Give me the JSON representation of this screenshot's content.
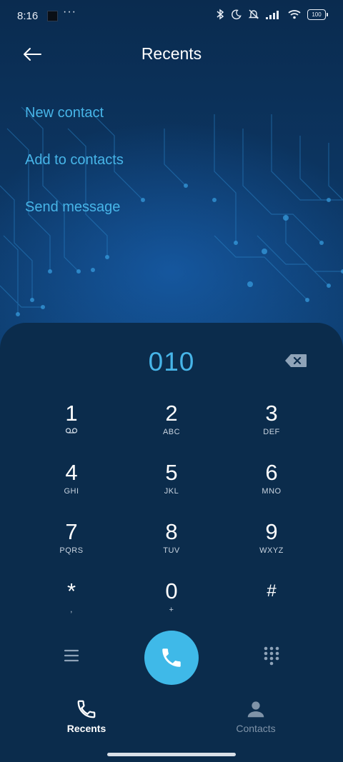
{
  "status_bar": {
    "time": "8:16",
    "more_dots": "···",
    "battery": "100"
  },
  "header": {
    "title": "Recents"
  },
  "actions": [
    {
      "label": "New contact"
    },
    {
      "label": "Add to contacts"
    },
    {
      "label": "Send message"
    }
  ],
  "dialer": {
    "number": "010",
    "keys": [
      {
        "digit": "1",
        "letters": ""
      },
      {
        "digit": "2",
        "letters": "ABC"
      },
      {
        "digit": "3",
        "letters": "DEF"
      },
      {
        "digit": "4",
        "letters": "GHI"
      },
      {
        "digit": "5",
        "letters": "JKL"
      },
      {
        "digit": "6",
        "letters": "MNO"
      },
      {
        "digit": "7",
        "letters": "PQRS"
      },
      {
        "digit": "8",
        "letters": "TUV"
      },
      {
        "digit": "9",
        "letters": "WXYZ"
      },
      {
        "digit": "*",
        "letters": ","
      },
      {
        "digit": "0",
        "letters": "+"
      },
      {
        "digit": "#",
        "letters": ""
      }
    ]
  },
  "bottom_nav": {
    "recents": "Recents",
    "contacts": "Contacts"
  },
  "colors": {
    "accent": "#47b5e8",
    "call_button": "#3fb9e8",
    "panel": "#0b2c4c",
    "inactive": "#7f93a8"
  },
  "icons": {
    "voicemail": "voicemail-icon",
    "backspace": "backspace-icon",
    "call": "phone-icon",
    "menu": "menu-icon",
    "dialpad": "dialpad-icon"
  }
}
